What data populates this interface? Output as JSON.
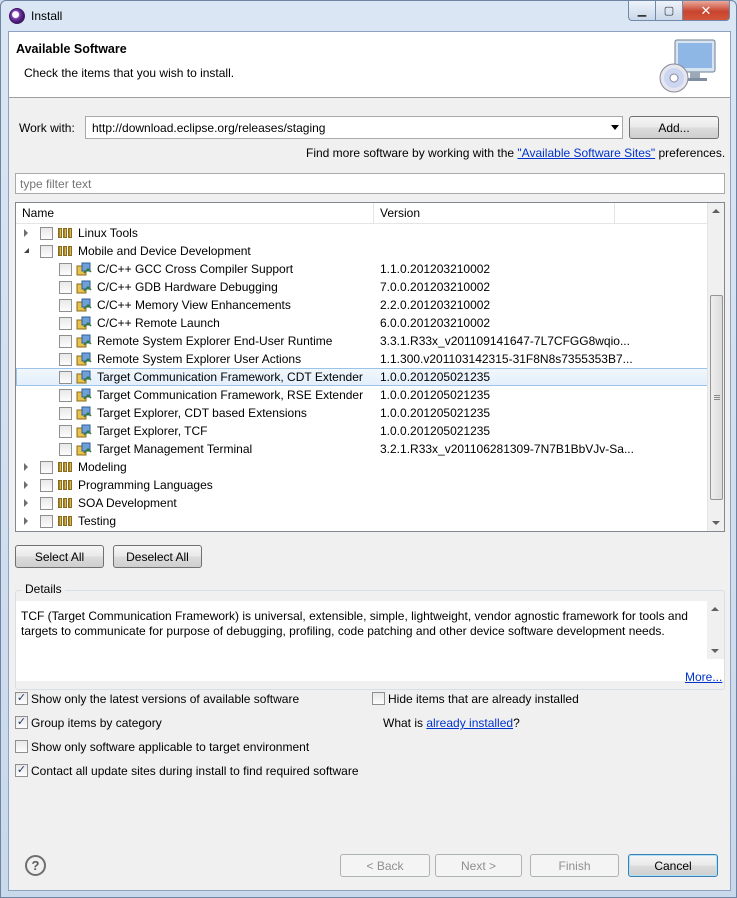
{
  "window": {
    "title": "Install",
    "controls": {
      "minimize": "▁",
      "maximize": "▢",
      "close": "✕"
    }
  },
  "banner": {
    "title": "Available Software",
    "description": "Check the items that you wish to install."
  },
  "work_with": {
    "label": "Work with:",
    "value": "http://download.eclipse.org/releases/staging",
    "add_button": "Add..."
  },
  "find_more": {
    "prefix": "Find more software by working with the ",
    "link": "\"Available Software Sites\"",
    "suffix": " preferences."
  },
  "filter": {
    "placeholder": "type filter text"
  },
  "tree": {
    "columns": {
      "name": "Name",
      "version": "Version"
    },
    "rows": [
      {
        "name": "Linux Tools",
        "version": "",
        "level": 0,
        "expander": "closed",
        "checked": false,
        "type": "category"
      },
      {
        "name": "Mobile and Device Development",
        "version": "",
        "level": 0,
        "expander": "open",
        "checked": false,
        "type": "category"
      },
      {
        "name": "C/C++ GCC Cross Compiler Support",
        "version": "1.1.0.201203210002",
        "level": 1,
        "expander": "none",
        "checked": false,
        "type": "feature"
      },
      {
        "name": "C/C++ GDB Hardware Debugging",
        "version": "7.0.0.201203210002",
        "level": 1,
        "expander": "none",
        "checked": false,
        "type": "feature"
      },
      {
        "name": "C/C++ Memory View Enhancements",
        "version": "2.2.0.201203210002",
        "level": 1,
        "expander": "none",
        "checked": false,
        "type": "feature"
      },
      {
        "name": "C/C++ Remote Launch",
        "version": "6.0.0.201203210002",
        "level": 1,
        "expander": "none",
        "checked": false,
        "type": "feature"
      },
      {
        "name": "Remote System Explorer End-User Runtime",
        "version": "3.3.1.R33x_v201109141647-7L7CFGG8wqio...",
        "level": 1,
        "expander": "none",
        "checked": false,
        "type": "feature"
      },
      {
        "name": "Remote System Explorer User Actions",
        "version": "1.1.300.v201103142315-31F8N8s7355353B7...",
        "level": 1,
        "expander": "none",
        "checked": false,
        "type": "feature"
      },
      {
        "name": "Target Communication Framework, CDT Extender",
        "version": "1.0.0.201205021235",
        "level": 1,
        "expander": "none",
        "checked": false,
        "type": "feature",
        "selected": true
      },
      {
        "name": "Target Communication Framework, RSE Extender",
        "version": "1.0.0.201205021235",
        "level": 1,
        "expander": "none",
        "checked": false,
        "type": "feature"
      },
      {
        "name": "Target Explorer, CDT based Extensions",
        "version": "1.0.0.201205021235",
        "level": 1,
        "expander": "none",
        "checked": false,
        "type": "feature"
      },
      {
        "name": "Target Explorer, TCF",
        "version": "1.0.0.201205021235",
        "level": 1,
        "expander": "none",
        "checked": false,
        "type": "feature"
      },
      {
        "name": "Target Management Terminal",
        "version": "3.2.1.R33x_v201106281309-7N7B1BbVJv-Sa...",
        "level": 1,
        "expander": "none",
        "checked": false,
        "type": "feature"
      },
      {
        "name": "Modeling",
        "version": "",
        "level": 0,
        "expander": "closed",
        "checked": false,
        "type": "category"
      },
      {
        "name": "Programming Languages",
        "version": "",
        "level": 0,
        "expander": "closed",
        "checked": false,
        "type": "category"
      },
      {
        "name": "SOA Development",
        "version": "",
        "level": 0,
        "expander": "closed",
        "checked": false,
        "type": "category"
      },
      {
        "name": "Testing",
        "version": "",
        "level": 0,
        "expander": "closed",
        "checked": false,
        "type": "category"
      }
    ]
  },
  "selection_buttons": {
    "select_all": "Select All",
    "deselect_all": "Deselect All"
  },
  "details": {
    "label": "Details",
    "text": "TCF (Target Communication Framework) is universal, extensible, simple, lightweight, vendor agnostic framework for tools and targets to communicate for purpose of debugging, profiling, code patching and other device software development needs.",
    "more_link": "More..."
  },
  "options": {
    "latest_versions": {
      "label": "Show only the latest versions of available software",
      "checked": true
    },
    "hide_installed": {
      "label": "Hide items that are already installed",
      "checked": false
    },
    "group_by_category": {
      "label": "Group items by category",
      "checked": true
    },
    "already_installed": {
      "prefix": "What is ",
      "link": "already installed",
      "suffix": "?"
    },
    "target_env": {
      "label": "Show only software applicable to target environment",
      "checked": false
    },
    "contact_sites": {
      "label": "Contact all update sites during install to find required software",
      "checked": true
    }
  },
  "footer": {
    "help": "?",
    "back": "< Back",
    "next": "Next >",
    "finish": "Finish",
    "cancel": "Cancel"
  },
  "icons": {
    "app": "eclipse-icon",
    "banner": "install-cd-monitor-icon",
    "category": "category-icon",
    "feature": "feature-plugin-icon",
    "check_mark": "✓"
  }
}
